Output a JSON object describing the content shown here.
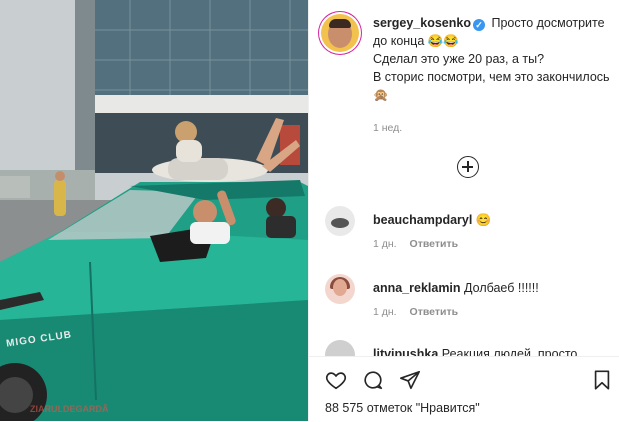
{
  "post": {
    "author": "sergey_kosenko",
    "caption_line1": "Просто досмотрите до конца 😂😂",
    "caption_line2": "Сделал это уже 20 раз, а ты?",
    "caption_line3": "В сторис посмотри, чем это закончилось 🙊",
    "time": "1 нед."
  },
  "media": {
    "car_badge": "MIGO CLUB",
    "watermark": "ZIARULDEGARDĂ"
  },
  "comments": [
    {
      "user": "beauchampdaryl",
      "text": "😊",
      "time": "1 дн.",
      "reply": "Ответить"
    },
    {
      "user": "anna_reklamin",
      "text": "Долбаеб !!!!!!",
      "time": "1 дн.",
      "reply": "Ответить"
    },
    {
      "user": "litvipushka",
      "text": "Реакция людей, просто"
    }
  ],
  "footer": {
    "likes": "88 575 отметок \"Нравится\""
  },
  "icons": [
    "heart-icon",
    "comment-icon",
    "share-icon",
    "bookmark-icon",
    "add-comments-icon",
    "verified-icon"
  ],
  "colors": {
    "verified": "#3897f0",
    "car": "#1e9e86",
    "muted_text": "#8e8e8e"
  }
}
